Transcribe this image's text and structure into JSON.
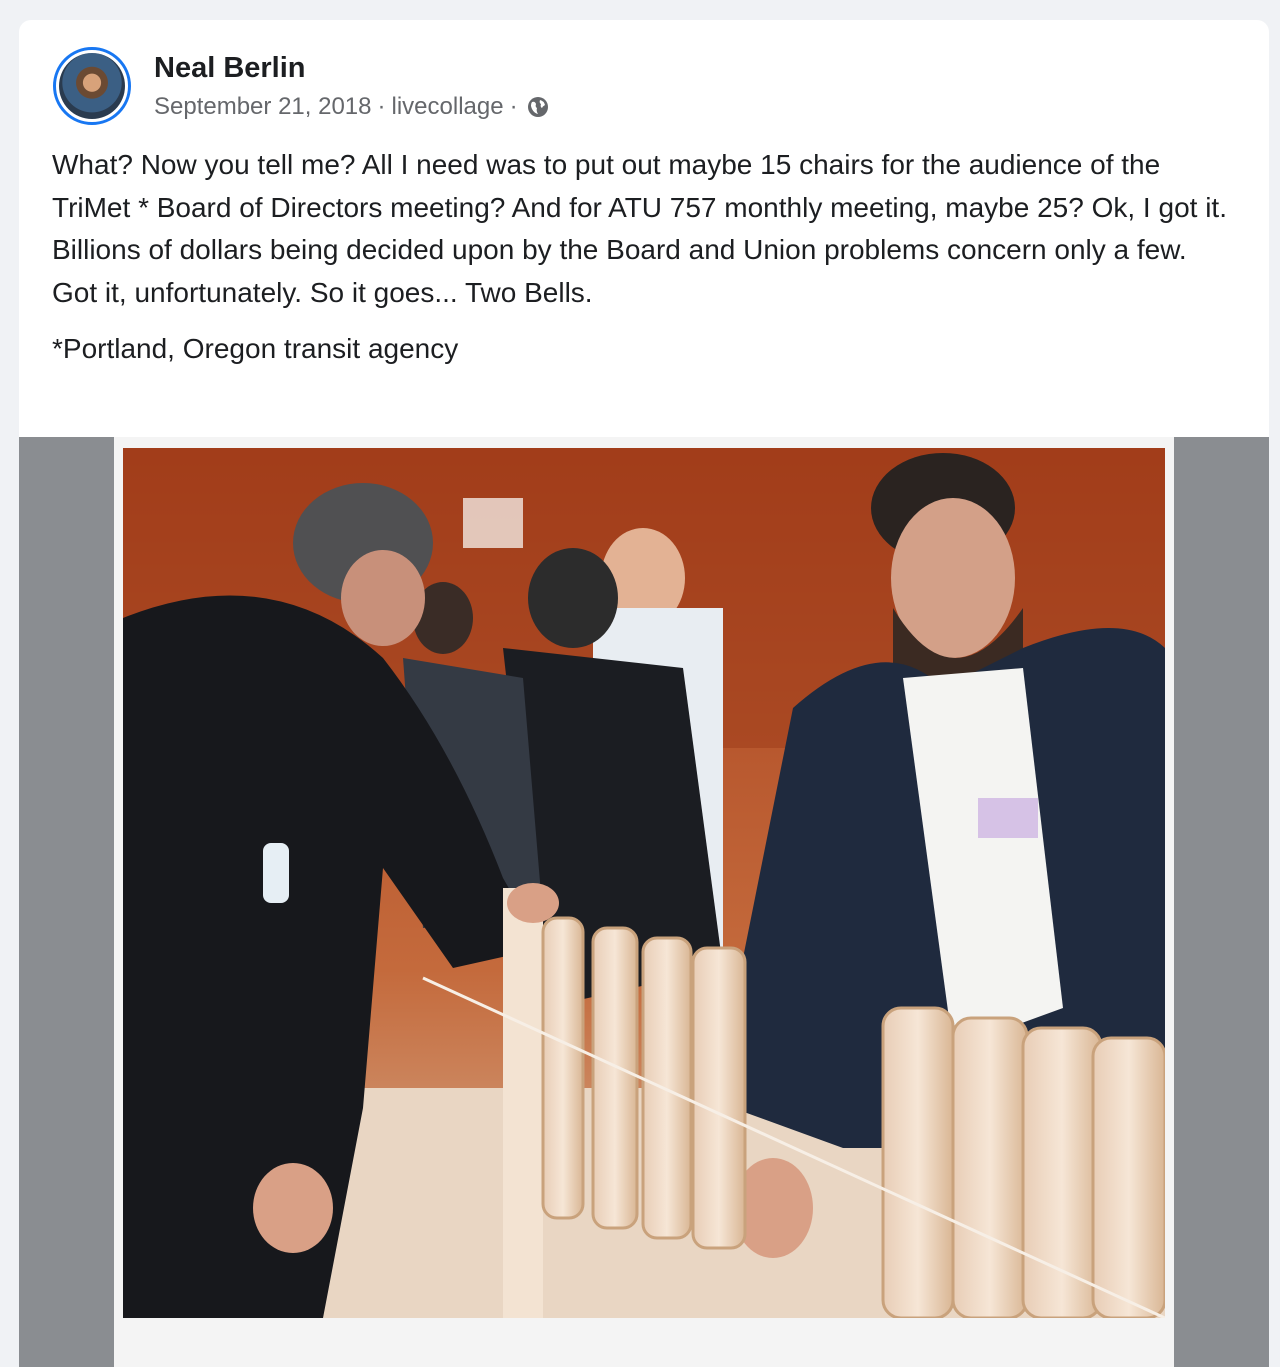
{
  "post": {
    "author": "Neal Berlin",
    "date": "September 21, 2018",
    "separator": "·",
    "app": "livecollage",
    "privacy_icon": "globe-icon",
    "text_p1": "What?  Now you tell me?  All I need was to put out maybe 15 chairs for the audience of the TriMet * Board of Directors meeting?  And for ATU 757 monthly meeting, maybe 25?  Ok, I got it. Billions of dollars  being decided upon by the Board and Union problems concern only a few.  Got it, unfortunately.  So it goes... Two Bells.",
    "text_p2": "*Portland, Oregon transit agency"
  },
  "colors": {
    "avatar_ring": "#1877f2",
    "author_text": "#1c1e21",
    "meta_text": "#65676b",
    "media_background": "#8a8d91",
    "photo_backdrop": "#b54a22"
  }
}
